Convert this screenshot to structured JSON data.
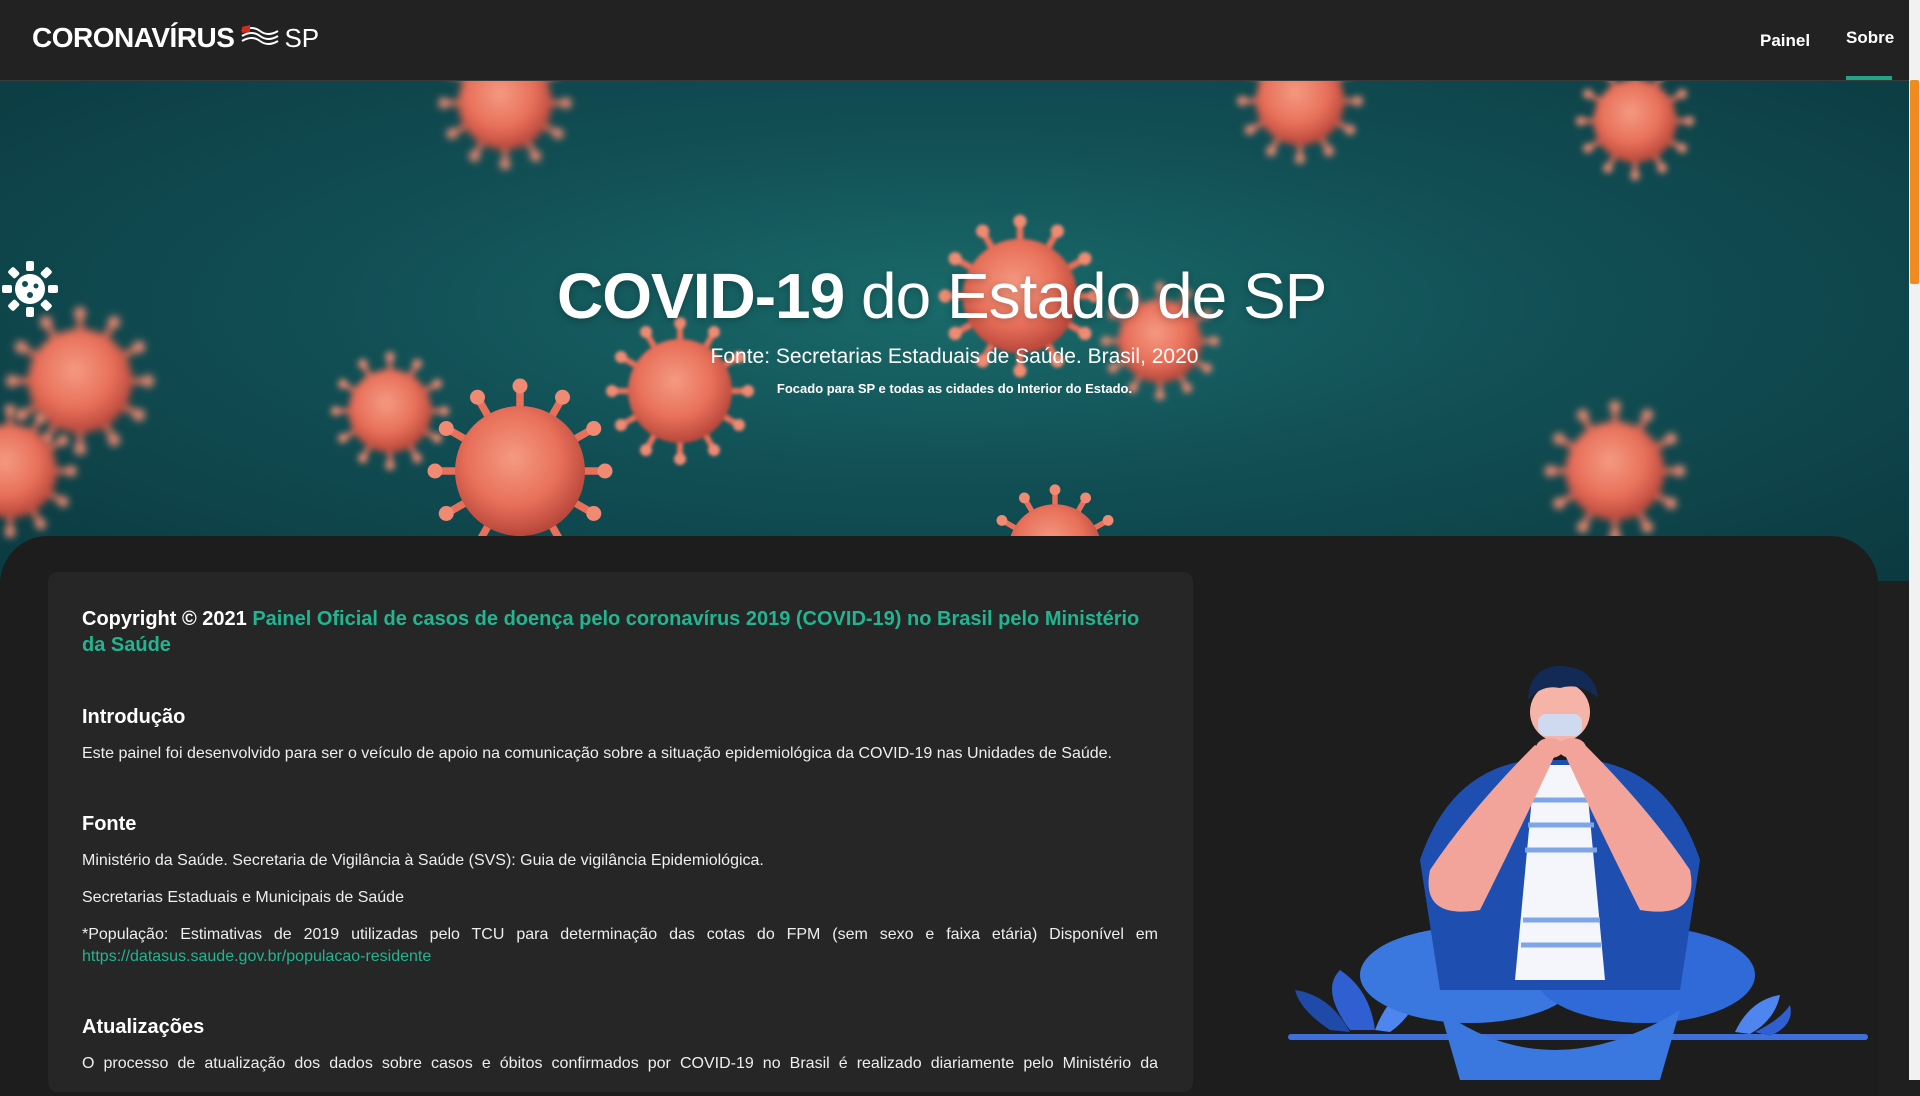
{
  "navbar": {
    "brand_main": "CORONAVÍRUS",
    "brand_suffix": "SP",
    "items": [
      {
        "label": "Painel"
      },
      {
        "label": "Sobre",
        "active": true
      }
    ]
  },
  "hero": {
    "title_bold": "COVID-19",
    "title_rest": "do Estado de SP",
    "subtitle": "Fonte: Secretarias Estaduais de Saúde. Brasil, 2020",
    "note": "Focado para SP e todas as cidades do Interior do Estado."
  },
  "about": {
    "copyright_prefix": "Copyright © 2021",
    "copyright_link": "Painel Oficial de casos de doença pelo coronavírus 2019 (COVID-19) no Brasil pelo Ministério da Saúde",
    "sections": [
      {
        "heading": "Introdução",
        "paragraphs": [
          "Este painel foi desenvolvido para ser o veículo de apoio na comunicação sobre a situação epidemiológica da COVID-19 nas Unidades de Saúde."
        ]
      },
      {
        "heading": "Fonte",
        "paragraphs": [
          "Ministério da Saúde. Secretaria de Vigilância à Saúde (SVS): Guia de vigilância Epidemiológica.",
          "Secretarias Estaduais e Municipais de Saúde",
          "*População: Estimativas de 2019 utilizadas pelo TCU para determinação das cotas do FPM (sem sexo e faixa etária) Disponível em"
        ],
        "link": "https://datasus.saude.gov.br/populacao-residente"
      },
      {
        "heading": "Atualizações",
        "paragraphs": [
          "O processo de atualização dos dados sobre casos e óbitos confirmados por COVID-19 no Brasil é realizado diariamente pelo Ministério da"
        ]
      }
    ]
  },
  "colors": {
    "accent": "#22a487",
    "link": "#22b591",
    "navbar_bg": "#222222",
    "page_bg": "#1f1f1f",
    "card_bg": "#262626",
    "hero_teal": "#114f55",
    "virus": "#e8705a",
    "scroll_thumb": "#f28b1d"
  },
  "icons": {
    "brand_flag": "sp-flag-stripes-icon",
    "hero_gear": "virus-gear-icon"
  }
}
